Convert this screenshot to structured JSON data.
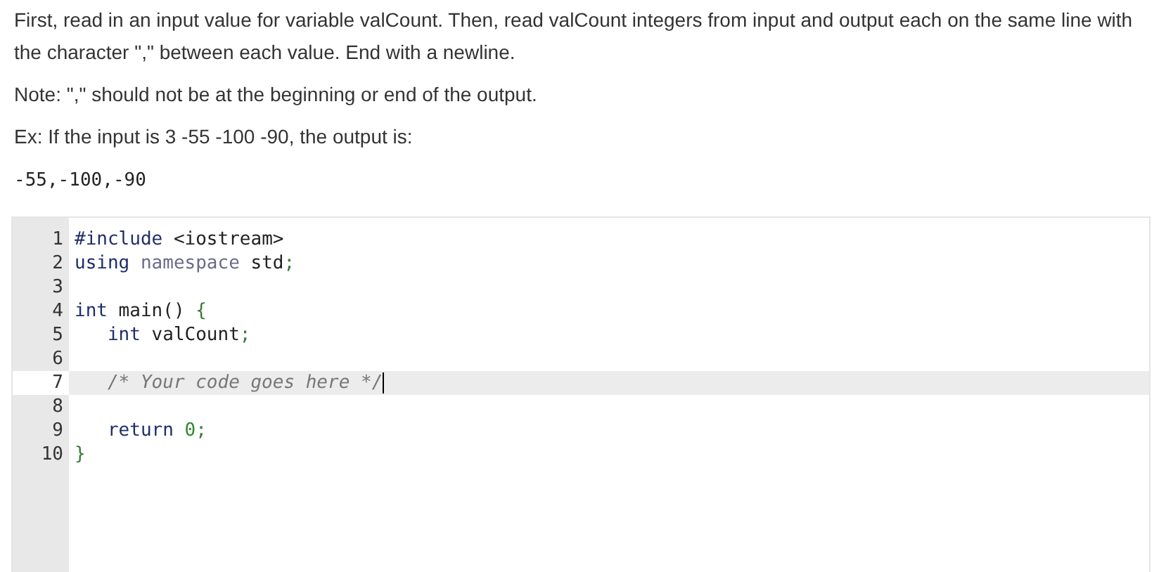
{
  "instructions": [
    "First, read in an input value for variable valCount. Then, read valCount integers from input and output each on the same line with the character \",\" between each value. End with a newline.",
    "Note: \",\" should not be at the beginning or end of the output.",
    "Ex: If the input is 3 -55 -100 -90, the output is:"
  ],
  "example_output": "-55,-100,-90",
  "editor": {
    "lines": [
      {
        "number": "1",
        "active": false,
        "tokens": [
          {
            "kind": "keyword",
            "text": "#include"
          },
          {
            "kind": "plain",
            "text": " <iostream>"
          }
        ]
      },
      {
        "number": "2",
        "active": false,
        "tokens": [
          {
            "kind": "keyword",
            "text": "using"
          },
          {
            "kind": "soft",
            "text": " namespace"
          },
          {
            "kind": "plain",
            "text": " std"
          },
          {
            "kind": "punct",
            "text": ";"
          }
        ]
      },
      {
        "number": "3",
        "active": false
      },
      {
        "number": "4",
        "active": false,
        "tokens": [
          {
            "kind": "keyword",
            "text": "int"
          },
          {
            "kind": "plain",
            "text": " main() "
          },
          {
            "kind": "punct",
            "text": "{"
          }
        ]
      },
      {
        "number": "5",
        "active": false,
        "tokens": [
          {
            "kind": "keyword",
            "text": "   int"
          },
          {
            "kind": "plain",
            "text": " valCount"
          },
          {
            "kind": "punct",
            "text": ";"
          }
        ]
      },
      {
        "number": "6",
        "active": false
      },
      {
        "number": "7",
        "active": true,
        "tokens": [
          {
            "kind": "comment",
            "text": "   /* Your code goes here */"
          }
        ]
      },
      {
        "number": "8",
        "active": false
      },
      {
        "number": "9",
        "active": false,
        "tokens": [
          {
            "kind": "keyword",
            "text": "   return"
          },
          {
            "kind": "number",
            "text": " 0"
          },
          {
            "kind": "punct",
            "text": ";"
          }
        ]
      },
      {
        "number": "10",
        "active": false,
        "tokens": [
          {
            "kind": "punct",
            "text": "}"
          }
        ]
      }
    ]
  }
}
